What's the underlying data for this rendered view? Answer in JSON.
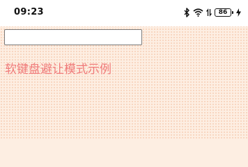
{
  "status_bar": {
    "time": "09:23",
    "battery_level": "86",
    "icons": [
      "bluetooth-icon",
      "wifi-icon",
      "data-transfer-icon",
      "battery-icon",
      "charging-icon"
    ]
  },
  "input": {
    "value": "",
    "placeholder": ""
  },
  "content": {
    "title": "软键盘避让模式示例",
    "title_color": "#f07a7a"
  },
  "colors": {
    "background": "#fdeee2"
  }
}
